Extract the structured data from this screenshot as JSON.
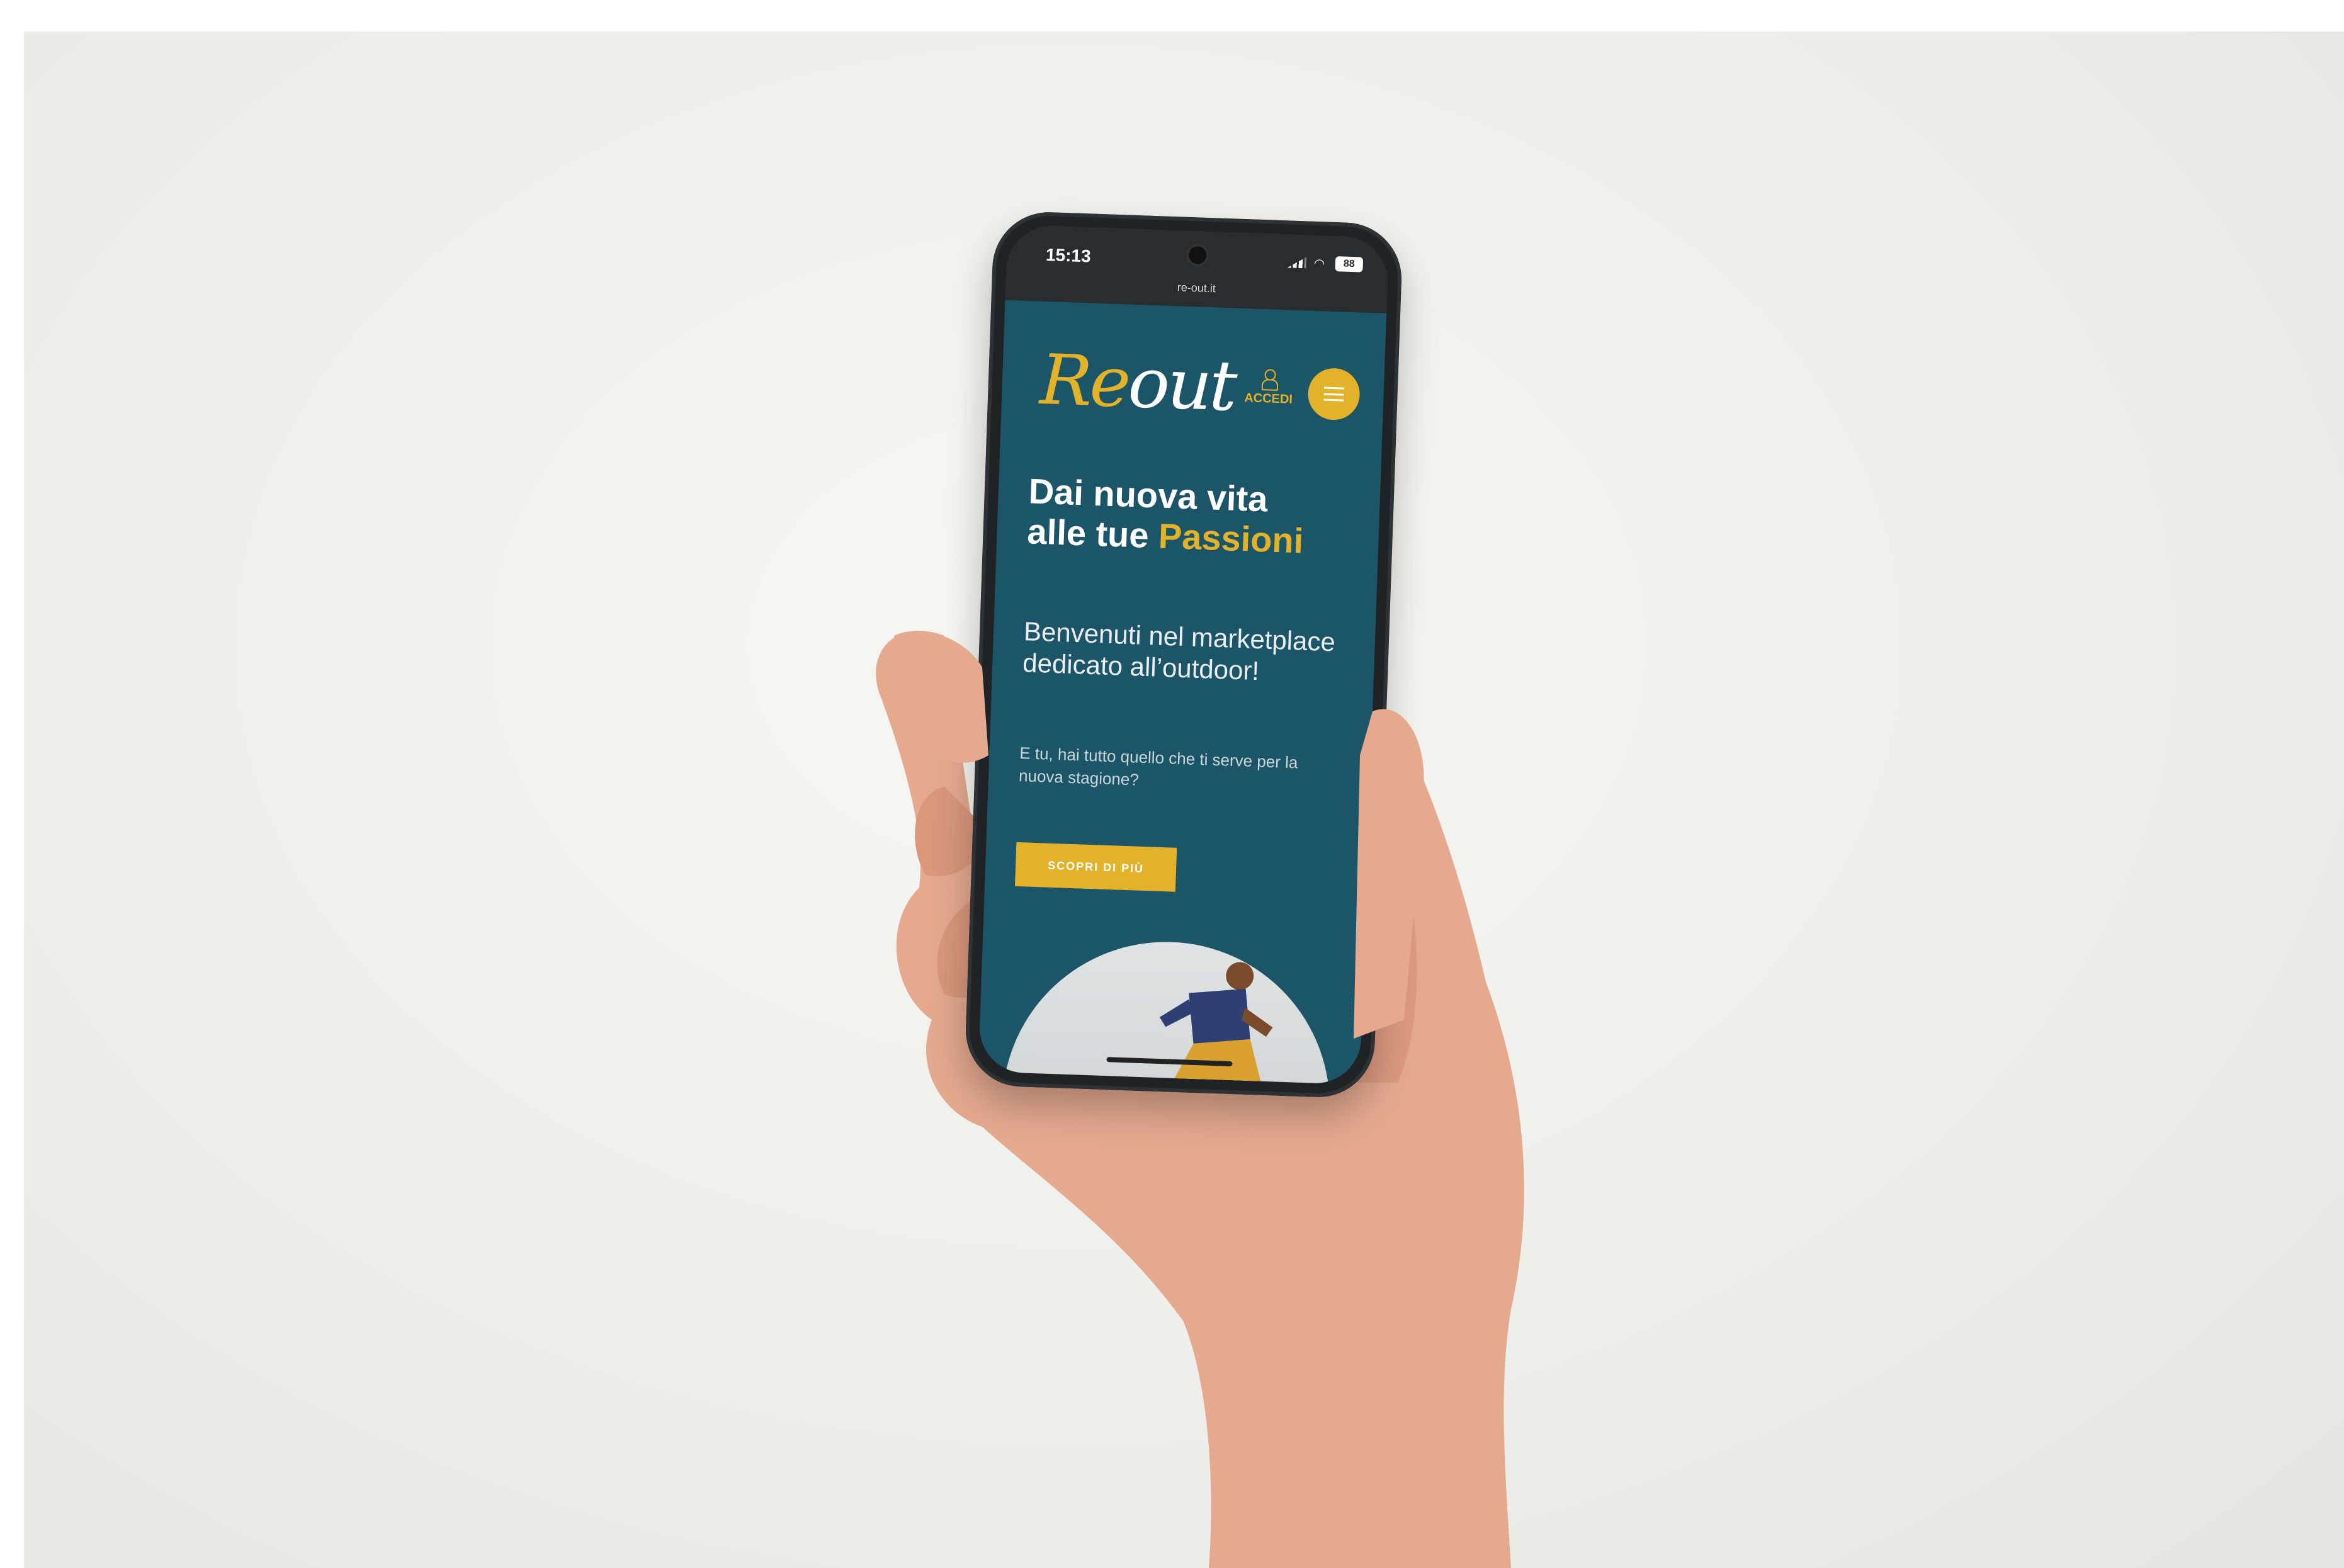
{
  "status_bar": {
    "time": "15:13",
    "battery": "88",
    "url": "re-out.it"
  },
  "site": {
    "logo": {
      "re": "Re",
      "out": "out"
    },
    "login_label": "ACCEDI",
    "hero": {
      "title_line1": "Dai nuova vita",
      "title_line2_prefix": "alle tue",
      "title_accent": "Passioni",
      "subtitle": "Benvenuti nel marketplace dedicato all’outdoor!",
      "body": "E tu, hai tutto quello che ti serve per la nuova stagione?",
      "cta_label": "SCOPRI DI PIÙ"
    }
  },
  "colors": {
    "brand_teal": "#1c5468",
    "brand_gold": "#e2b22b"
  },
  "icons": [
    "signal-icon",
    "wifi-icon",
    "battery-icon",
    "user-icon",
    "menu-icon"
  ]
}
